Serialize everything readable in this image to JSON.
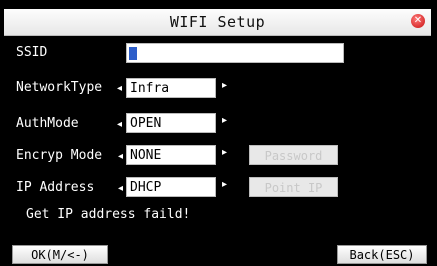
{
  "window": {
    "title": "WIFI Setup"
  },
  "fields": {
    "ssid": {
      "label": "SSID",
      "value": ""
    },
    "network_type": {
      "label": "NetworkType",
      "value": "Infra"
    },
    "auth_mode": {
      "label": "AuthMode",
      "value": "OPEN"
    },
    "encryp_mode": {
      "label": "Encryp Mode",
      "value": "NONE"
    },
    "ip_address": {
      "label": "IP Address",
      "value": "DHCP"
    }
  },
  "buttons": {
    "password": "Password",
    "point_ip": "Point IP",
    "ok": "OK(M/<-)",
    "back": "Back(ESC)"
  },
  "status": "Get IP address faild!"
}
